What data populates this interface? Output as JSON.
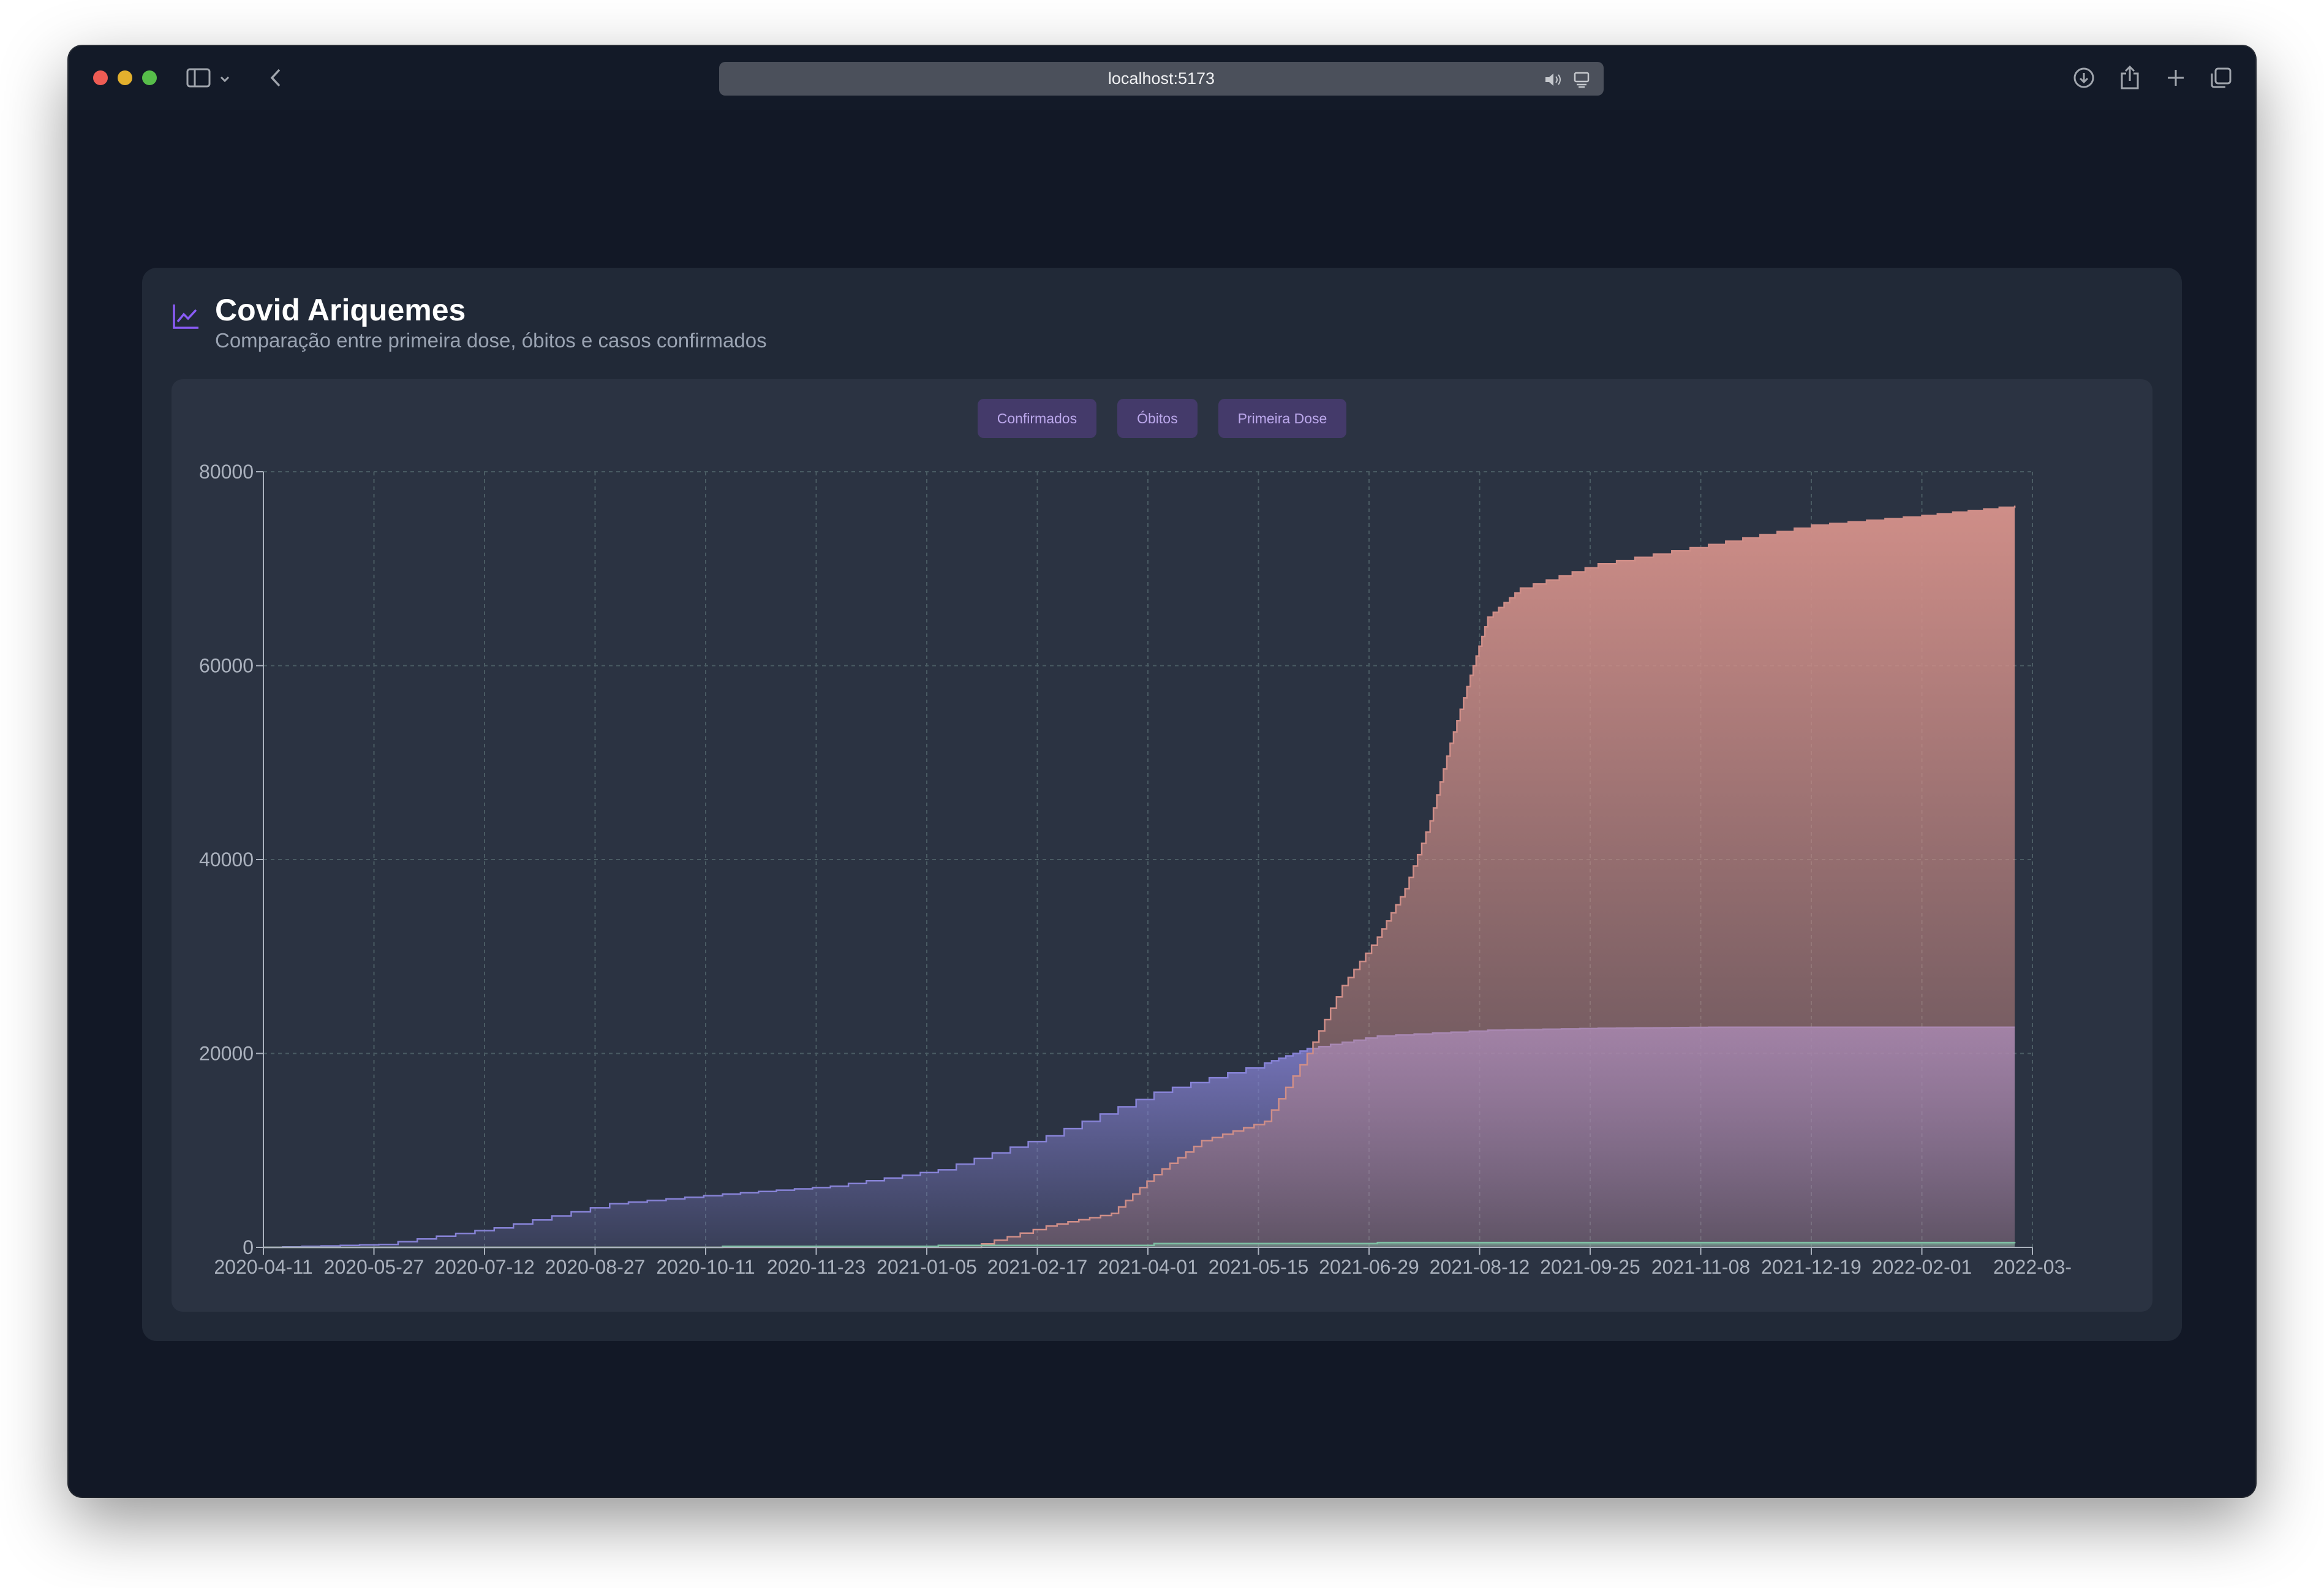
{
  "browser": {
    "url": "localhost:5173"
  },
  "page": {
    "title": "Covid Ariquemes",
    "subtitle": "Comparação entre primeira dose, óbitos e casos confirmados"
  },
  "legend": {
    "confirmados": "Confirmados",
    "obitos": "Óbitos",
    "primeira_dose": "Primeira Dose"
  },
  "chart_data": {
    "type": "area",
    "grid": true,
    "ylim": [
      0,
      80000
    ],
    "y_ticks": [
      0,
      20000,
      40000,
      60000,
      80000
    ],
    "x_ticks": [
      "2020-04-11",
      "2020-05-27",
      "2020-07-12",
      "2020-08-27",
      "2020-10-11",
      "2020-11-23",
      "2021-01-05",
      "2021-02-17",
      "2021-04-01",
      "2021-05-15",
      "2021-06-29",
      "2021-08-12",
      "2021-09-25",
      "2021-11-08",
      "2021-12-19",
      "2022-02-01",
      "2022-03-"
    ],
    "series": [
      {
        "name": "Confirmados",
        "color": "#8783d6",
        "points": [
          [
            "2020-04-11",
            0
          ],
          [
            "2020-05-27",
            300
          ],
          [
            "2020-07-12",
            2000
          ],
          [
            "2020-08-27",
            4500
          ],
          [
            "2020-10-11",
            5500
          ],
          [
            "2020-11-23",
            6300
          ],
          [
            "2021-01-05",
            8000
          ],
          [
            "2021-02-17",
            11500
          ],
          [
            "2021-04-01",
            16000
          ],
          [
            "2021-05-15",
            19000
          ],
          [
            "2021-06-01",
            20500
          ],
          [
            "2021-06-29",
            21800
          ],
          [
            "2021-08-12",
            22400
          ],
          [
            "2021-09-25",
            22600
          ],
          [
            "2021-11-08",
            22700
          ],
          [
            "2022-03-10",
            22700
          ]
        ]
      },
      {
        "name": "Óbitos",
        "color": "#7fbfa4",
        "points": [
          [
            "2020-04-11",
            0
          ],
          [
            "2020-10-11",
            100
          ],
          [
            "2021-01-05",
            200
          ],
          [
            "2021-04-01",
            400
          ],
          [
            "2021-06-29",
            500
          ],
          [
            "2022-03-10",
            550
          ]
        ]
      },
      {
        "name": "Primeira Dose",
        "color": "#cf8e88",
        "points": [
          [
            "2020-04-11",
            0
          ],
          [
            "2021-01-17",
            0
          ],
          [
            "2021-02-17",
            2200
          ],
          [
            "2021-03-15",
            3500
          ],
          [
            "2021-04-01",
            7500
          ],
          [
            "2021-04-20",
            11000
          ],
          [
            "2021-05-15",
            13000
          ],
          [
            "2021-06-01",
            20000
          ],
          [
            "2021-06-15",
            27000
          ],
          [
            "2021-06-29",
            32000
          ],
          [
            "2021-07-10",
            37000
          ],
          [
            "2021-07-20",
            44000
          ],
          [
            "2021-07-28",
            52000
          ],
          [
            "2021-08-05",
            59000
          ],
          [
            "2021-08-12",
            65000
          ],
          [
            "2021-08-25",
            68000
          ],
          [
            "2021-09-25",
            70500
          ],
          [
            "2021-11-08",
            72500
          ],
          [
            "2021-12-19",
            74500
          ],
          [
            "2022-02-01",
            75500
          ],
          [
            "2022-03-10",
            76500
          ]
        ]
      }
    ]
  }
}
